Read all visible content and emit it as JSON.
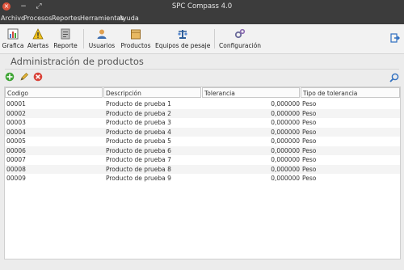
{
  "window": {
    "title": "SPC Compass 4.0",
    "close_glyph": "×",
    "min_glyph": "−",
    "max_glyph": "⤢"
  },
  "menu": [
    "Archivo",
    "Procesos",
    "Reportes",
    "Herramientas",
    "Ayuda"
  ],
  "toolbar": {
    "items": [
      {
        "label": "Grafica",
        "icon": "chart-icon"
      },
      {
        "label": "Alertas",
        "icon": "warning-icon"
      },
      {
        "label": "Reporte",
        "icon": "report-icon"
      },
      {
        "label": "Usuarios",
        "icon": "users-icon"
      },
      {
        "label": "Productos",
        "icon": "box-icon"
      },
      {
        "label": "Equipos de pesaje",
        "icon": "scale-icon"
      },
      {
        "label": "Configuración",
        "icon": "gears-icon"
      }
    ],
    "exit_icon": "exit-icon"
  },
  "panel": {
    "title": "Administración de productos"
  },
  "actions": {
    "add_icon": "add-icon",
    "edit_icon": "pencil-icon",
    "delete_icon": "delete-icon",
    "search_icon": "search-icon"
  },
  "table": {
    "columns": [
      "Codigo",
      "Descripción",
      "Tolerancia",
      "Tipo de tolerancia"
    ],
    "rows": [
      [
        "00001",
        "Producto de prueba 1",
        "0,000000",
        "Peso"
      ],
      [
        "00002",
        "Producto de prueba 2",
        "0,000000",
        "Peso"
      ],
      [
        "00003",
        "Producto de prueba 3",
        "0,000000",
        "Peso"
      ],
      [
        "00004",
        "Producto de prueba 4",
        "0,000000",
        "Peso"
      ],
      [
        "00005",
        "Producto de prueba 5",
        "0,000000",
        "Peso"
      ],
      [
        "00006",
        "Producto de prueba 6",
        "0,000000",
        "Peso"
      ],
      [
        "00007",
        "Producto de prueba 7",
        "0,000000",
        "Peso"
      ],
      [
        "00008",
        "Producto de prueba 8",
        "0,000000",
        "Peso"
      ],
      [
        "00009",
        "Producto de prueba 9",
        "0,000000",
        "Peso"
      ]
    ]
  },
  "colors": {
    "titlebar": "#3c3c3c",
    "close": "#e0533b",
    "add": "#3fa535",
    "delete": "#d9443a"
  }
}
